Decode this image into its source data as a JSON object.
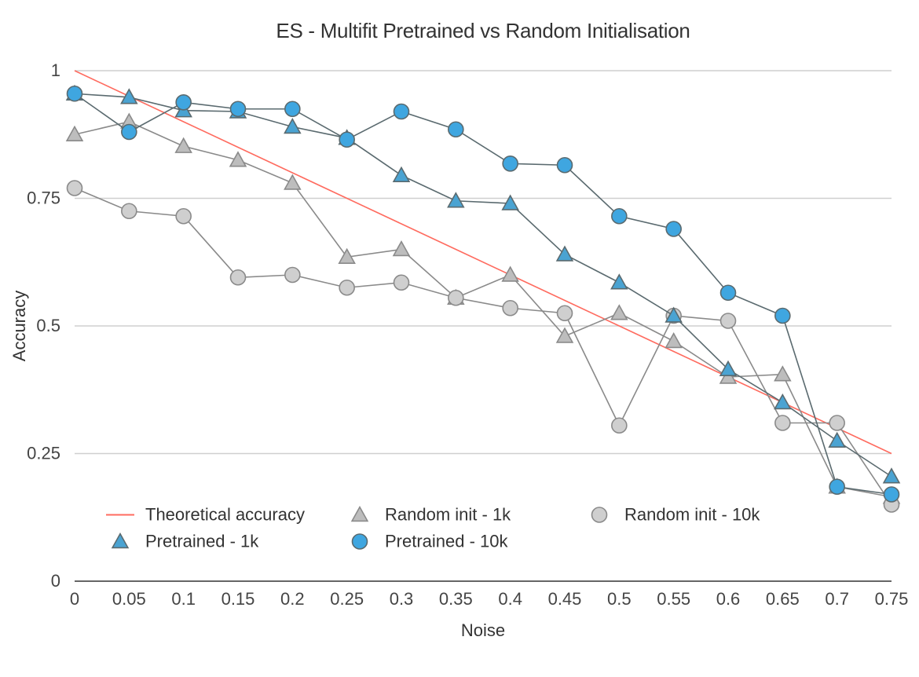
{
  "chart_data": {
    "type": "line",
    "title": "ES - Multifit Pretrained vs Random Initialisation",
    "xlabel": "Noise",
    "ylabel": "Accuracy",
    "xlim": [
      0,
      0.75
    ],
    "ylim": [
      0,
      1
    ],
    "x_ticks": [
      0,
      0.05,
      0.1,
      0.15,
      0.2,
      0.25,
      0.3,
      0.35,
      0.4,
      0.45,
      0.5,
      0.55,
      0.6,
      0.65,
      0.7,
      0.75
    ],
    "y_ticks": [
      0,
      0.25,
      0.5,
      0.75,
      1
    ],
    "grid_y": [
      0.25,
      0.5,
      0.75,
      1
    ],
    "x": [
      0,
      0.05,
      0.1,
      0.15,
      0.2,
      0.25,
      0.3,
      0.35,
      0.4,
      0.45,
      0.5,
      0.55,
      0.6,
      0.65,
      0.7,
      0.75
    ],
    "series": [
      {
        "name": "Theoretical accuracy",
        "kind": "line",
        "color": "#ff6b5f",
        "values": [
          1.0,
          0.95,
          0.9,
          0.85,
          0.8,
          0.75,
          0.7,
          0.65,
          0.6,
          0.55,
          0.5,
          0.45,
          0.4,
          0.35,
          0.3,
          0.25
        ],
        "marker": "none"
      },
      {
        "name": "Random init - 1k",
        "kind": "line-markers",
        "color": "#bdbdbd",
        "stroke": "#8a8a8a",
        "marker": "triangle",
        "values": [
          0.875,
          0.9,
          0.852,
          0.825,
          0.78,
          0.635,
          0.65,
          0.555,
          0.6,
          0.48,
          0.525,
          0.47,
          0.4,
          0.405,
          0.185,
          0.165
        ]
      },
      {
        "name": "Random init - 10k",
        "kind": "line-markers",
        "color": "#cfcfcf",
        "stroke": "#8a8a8a",
        "marker": "circle",
        "values": [
          0.77,
          0.725,
          0.715,
          0.595,
          0.6,
          0.575,
          0.585,
          0.555,
          0.535,
          0.525,
          0.305,
          0.52,
          0.51,
          0.31,
          0.31,
          0.15
        ]
      },
      {
        "name": "Pretrained - 1k",
        "kind": "line-markers",
        "color": "#4aa3d2",
        "stroke": "#5a6a6f",
        "marker": "triangle",
        "values": [
          0.955,
          0.948,
          0.922,
          0.92,
          0.89,
          0.868,
          0.795,
          0.745,
          0.74,
          0.64,
          0.585,
          0.52,
          0.415,
          0.35,
          0.275,
          0.205
        ]
      },
      {
        "name": "Pretrained - 10k",
        "kind": "line-markers",
        "color": "#3fa6e0",
        "stroke": "#5a6a6f",
        "marker": "circle",
        "values": [
          0.955,
          0.88,
          0.938,
          0.925,
          0.925,
          0.865,
          0.92,
          0.885,
          0.818,
          0.815,
          0.715,
          0.69,
          0.565,
          0.52,
          0.185,
          0.17
        ]
      }
    ],
    "legend": {
      "columns": 3,
      "position": "bottom-inside",
      "items": [
        "Theoretical accuracy",
        "Random init - 1k",
        "Random init - 10k",
        "Pretrained - 1k",
        "Pretrained - 10k"
      ]
    }
  }
}
